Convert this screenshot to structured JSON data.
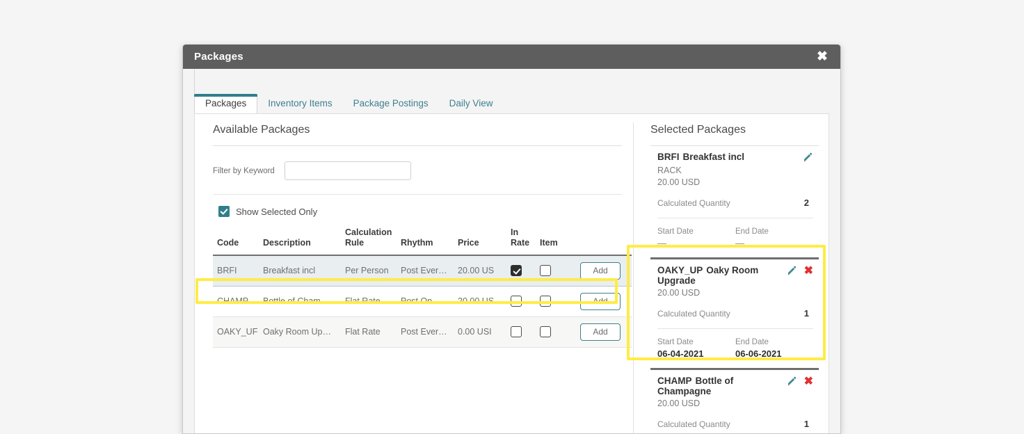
{
  "window": {
    "title": "Packages",
    "close_label": "✖"
  },
  "tabs": [
    {
      "label": "Packages",
      "active": true
    },
    {
      "label": "Inventory Items",
      "active": false
    },
    {
      "label": "Package Postings",
      "active": false
    },
    {
      "label": "Daily View",
      "active": false
    }
  ],
  "available": {
    "title": "Available Packages",
    "filter": {
      "label": "Filter by Keyword",
      "value": "",
      "placeholder": ""
    },
    "show_selected_only": {
      "label": "Show Selected Only",
      "checked": true
    },
    "columns": [
      "Code",
      "Description",
      "Calculation Rule",
      "Rhythm",
      "Price",
      "In Rate",
      "Item",
      ""
    ],
    "add_label": "Add",
    "rows": [
      {
        "code": "BRFI",
        "description": "Breakfast incl",
        "calculation_rule": "Per Person",
        "rhythm": "Post Ever…",
        "price": "20.00 US",
        "in_rate": true,
        "item": false,
        "state": "selected"
      },
      {
        "code": "CHAMP",
        "description": "Bottle of Cham…",
        "calculation_rule": "Flat Rate",
        "rhythm": "Post On …",
        "price": "20.00 US",
        "in_rate": false,
        "item": false,
        "state": "normal"
      },
      {
        "code": "OAKY_UF",
        "description": "Oaky Room Up…",
        "calculation_rule": "Flat Rate",
        "rhythm": "Post Ever…",
        "price": "0.00 USI",
        "in_rate": false,
        "item": false,
        "state": "highlighted"
      }
    ]
  },
  "selected": {
    "title": "Selected Packages",
    "quantity_label": "Calculated Quantity",
    "start_date_label": "Start Date",
    "end_date_label": "End Date",
    "cards": [
      {
        "code": "BRFI",
        "name": "Breakfast incl",
        "rate_code": "RACK",
        "price": "20.00 USD",
        "calculated_quantity": "2",
        "start_date": "—",
        "end_date": "—",
        "has_delete": false,
        "highlighted": false
      },
      {
        "code": "OAKY_UP",
        "name": "Oaky Room Upgrade",
        "rate_code": "",
        "price": "20.00 USD",
        "calculated_quantity": "1",
        "start_date": "06-04-2021",
        "end_date": "06-06-2021",
        "has_delete": true,
        "highlighted": true
      },
      {
        "code": "CHAMP",
        "name": "Bottle of Champagne",
        "rate_code": "",
        "price": "20.00 USD",
        "calculated_quantity": "1",
        "start_date": "",
        "end_date": "",
        "has_delete": true,
        "highlighted": false
      }
    ]
  },
  "colors": {
    "titlebar": "#5e5e5e",
    "accent_teal": "#2f7f8a",
    "highlight_yellow": "#ffec46",
    "delete_red": "#e03131"
  }
}
